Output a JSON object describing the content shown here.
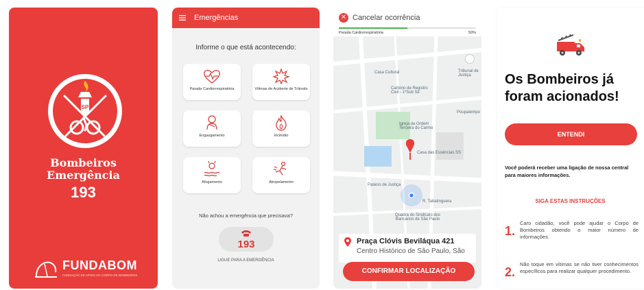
{
  "colors": {
    "brand_red": "#e83d3a",
    "map_green": "#4caf50"
  },
  "splash": {
    "line1": "Bombeiros",
    "line2": "Emergência",
    "number": "193",
    "org_name": "FUNDABOM",
    "org_tagline": "FUNDAÇÃO DE APOIO AO CORPO DE BOMBEIROS"
  },
  "emergencias": {
    "menu_icon": "hamburger-menu-icon",
    "title": "Emergências",
    "prompt": "Informe o que está acontecendo:",
    "options": [
      {
        "label": "Parada Cardiorrespiratória",
        "icon": "heart-pulse-icon"
      },
      {
        "label": "Vítimas de Acidente de Trânsito",
        "icon": "car-crash-icon"
      },
      {
        "label": "Engasgamento",
        "icon": "choking-icon"
      },
      {
        "label": "Incêndio",
        "icon": "fire-icon"
      },
      {
        "label": "Afogamento",
        "icon": "drowning-icon"
      },
      {
        "label": "Atropelamento",
        "icon": "pedestrian-hit-icon"
      }
    ],
    "not_found": "Não achou a emergência que precisava?",
    "call_number": "193",
    "call_label": "LIGUE PARA A EMERGÊNCIA"
  },
  "mapa": {
    "cancel_label": "Cancelar ocorrência",
    "progress_label": "Parada Cardiorrespiratória",
    "progress_pct": "50%",
    "progress_value": 0.5,
    "map_labels": [
      "Casa Cultural",
      "Cartório de Registro Civil - 1ºSub Sé",
      "Igreja da Ordem Terceira do Carmo",
      "Casa das Essências SS",
      "Palácio de Justiça",
      "Quadra do Sindicato dos Bancários de São Paulo",
      "R. Tabatinguera",
      "Poupatempo",
      "Tribunal de Justiça"
    ],
    "address_title": "Praça Clóvis Beviláqua 421",
    "address_sub": "Centro Histórico de São Paulo, São",
    "confirm_label": "CONFIRMAR LOCALIZAÇÃO"
  },
  "confirmacao": {
    "title_line1": "Os Bombeiros já",
    "title_line2": "foram acionados!",
    "ok_label": "ENTENDI",
    "info": "Você poderá receber uma ligação de nossa central para maiores informações.",
    "follow": "SIGA ESTAS INSTRUÇÕES",
    "steps": [
      {
        "n": "1.",
        "text": "Caro cidadão, você pode ajudar o Corpo de Bombeiros obtendo o maior número de informações."
      },
      {
        "n": "2.",
        "text": "Não toque em vítimas se não tiver conhecimentos específicos para realizar qualquer procedimento."
      }
    ]
  }
}
